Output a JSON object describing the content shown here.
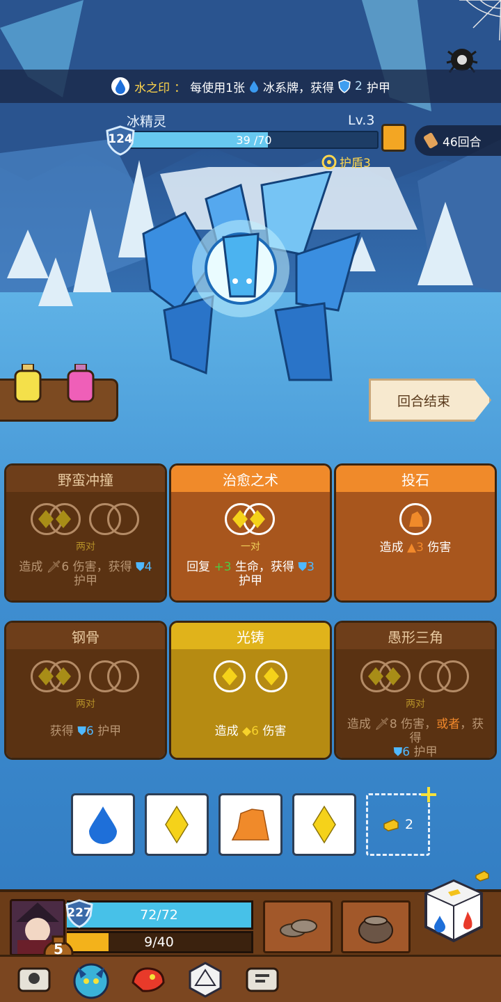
{
  "banner": {
    "seal_label": "水之印",
    "separator": "：",
    "text_a": "每使用1张",
    "text_b": "冰系牌，获得",
    "armor_value": "2",
    "text_c": "护甲"
  },
  "enemy": {
    "name": "冰精灵",
    "level": "Lv.3",
    "shield": "124",
    "hp_text": "39 /70",
    "hp_fraction": 0.557,
    "armor_label": "护盾3"
  },
  "turns": {
    "label": "46回合"
  },
  "end_turn": {
    "label": "回合结束"
  },
  "cards": [
    {
      "title": "野蛮冲撞",
      "state": "dim",
      "sub": "两对",
      "desc_a": "造成",
      "val1": "6",
      "desc_b": "伤害，获得",
      "val2": "4",
      "desc_c": "护甲"
    },
    {
      "title": "治愈之术",
      "state": "active",
      "sub": "一对",
      "desc_a": "回复",
      "val1": "+3",
      "desc_b": "生命，获得",
      "val2": "3",
      "desc_c": "护甲"
    },
    {
      "title": "投石",
      "state": "active",
      "desc_a": "造成",
      "val1": "3",
      "desc_b": "伤害"
    },
    {
      "title": "钢骨",
      "state": "dim",
      "sub": "两对",
      "desc_a": "获得",
      "val1": "6",
      "desc_b": "护甲"
    },
    {
      "title": "光铸",
      "state": "gold",
      "desc_a": "造成",
      "val1": "6",
      "desc_b": "伤害"
    },
    {
      "title": "愚形三角",
      "state": "dim",
      "sub": "两对",
      "desc_a": "造成",
      "val1": "8",
      "desc_b": "伤害，",
      "or": "或者",
      "desc_c": "，获得",
      "val2": "6",
      "desc_d": "护甲"
    }
  ],
  "dice": [
    "water-drop",
    "yellow-diamond",
    "orange-rock",
    "yellow-diamond"
  ],
  "add_slot": {
    "count": "2"
  },
  "player": {
    "shield": "227",
    "hp_text": "72/72",
    "hp_fraction": 1.0,
    "xp_text": "9/40",
    "xp_fraction": 0.225,
    "coins": "5"
  },
  "colors": {
    "water": "#1e6fd9",
    "gem": "#f5d21a",
    "rock": "#f08a2a",
    "ice": "#67c8ef"
  }
}
